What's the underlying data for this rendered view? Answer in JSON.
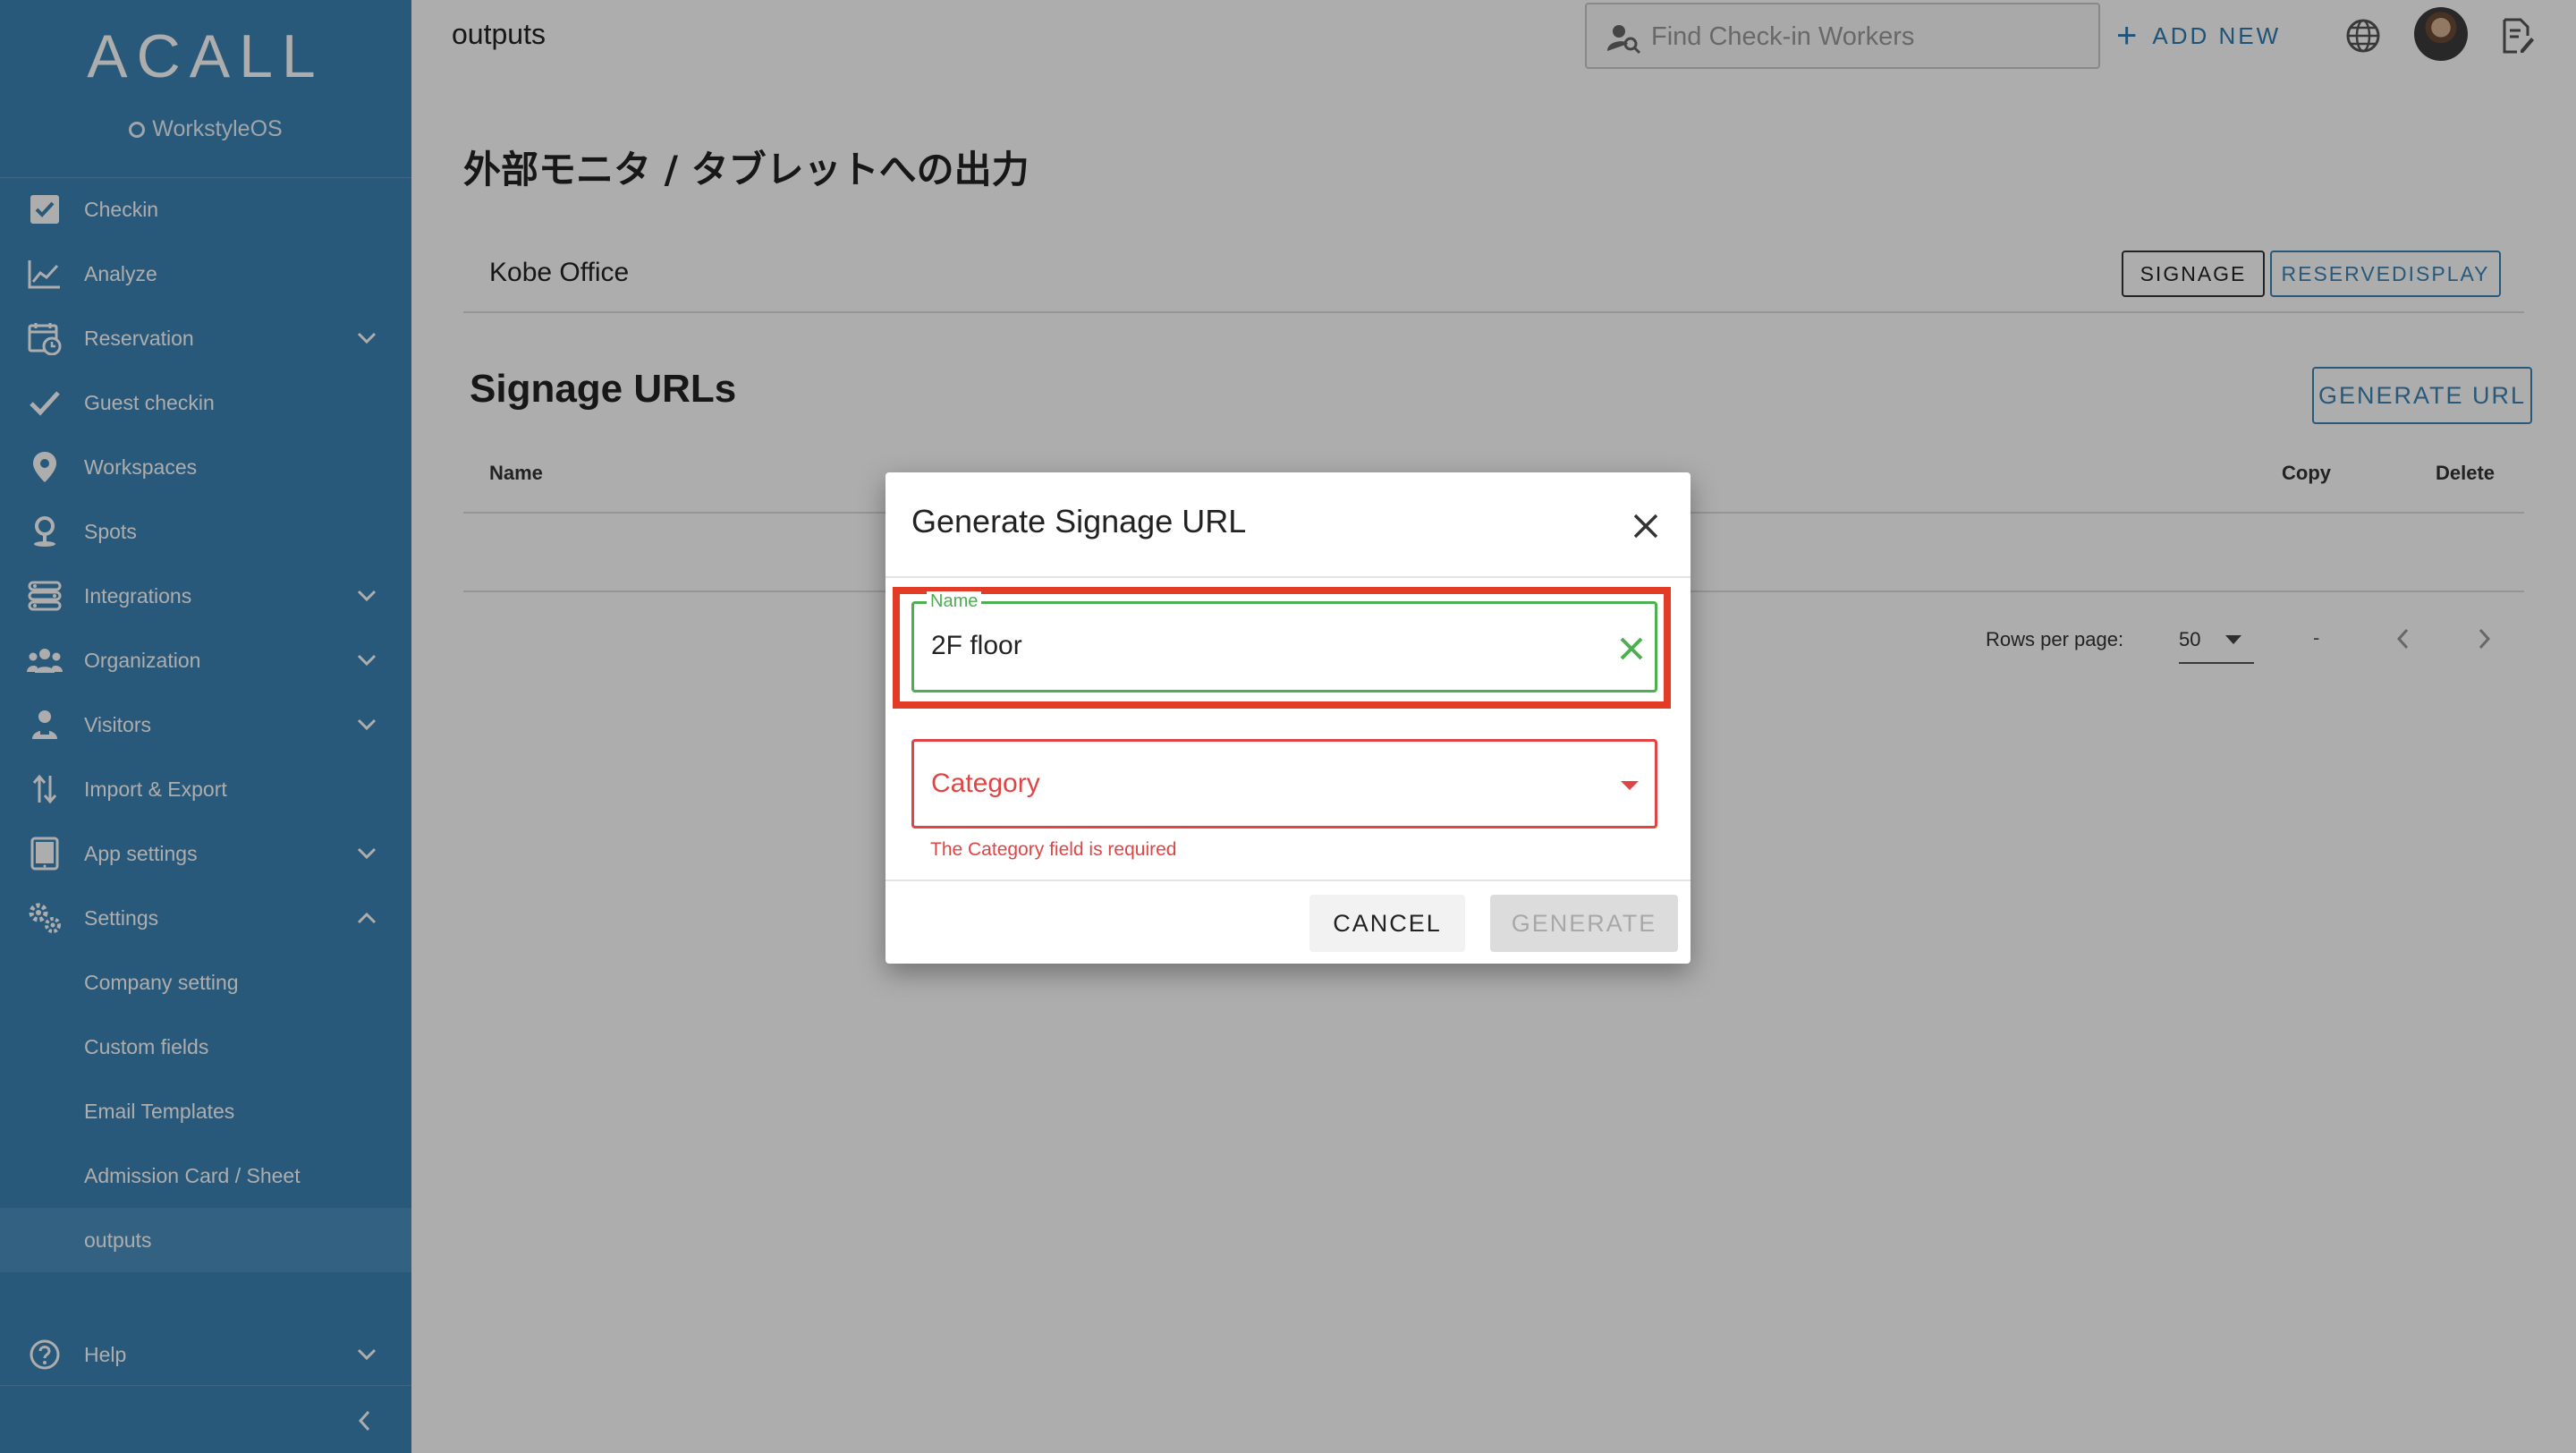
{
  "sidebar": {
    "logo": "ACALL",
    "logo_sub": "WorkstyleOS",
    "items": [
      {
        "label": "Checkin",
        "icon": "checkbox-icon"
      },
      {
        "label": "Analyze",
        "icon": "line-chart-icon"
      },
      {
        "label": "Reservation",
        "icon": "calendar-clock-icon"
      },
      {
        "label": "Guest checkin",
        "icon": "check-icon"
      },
      {
        "label": "Workspaces",
        "icon": "map-pin-icon"
      },
      {
        "label": "Spots",
        "icon": "spot-pin-icon"
      },
      {
        "label": "Integrations",
        "icon": "integrations-icon"
      },
      {
        "label": "Organization",
        "icon": "people-icon"
      },
      {
        "label": "Visitors",
        "icon": "visitor-icon"
      },
      {
        "label": "Import & Export",
        "icon": "import-export-icon"
      },
      {
        "label": "App settings",
        "icon": "tablet-icon"
      },
      {
        "label": "Settings",
        "icon": "gears-icon"
      }
    ],
    "settings_sub": [
      {
        "label": "Company setting"
      },
      {
        "label": "Custom fields"
      },
      {
        "label": "Email Templates"
      },
      {
        "label": "Admission Card / Sheet"
      },
      {
        "label": "outputs"
      }
    ],
    "help": "Help"
  },
  "topbar": {
    "title": "outputs",
    "search_placeholder": "Find Check-in Workers",
    "add_new": "ADD NEW"
  },
  "main": {
    "heading": "外部モニタ / タブレットへの出力",
    "office": "Kobe Office",
    "tabs": [
      "SIGNAGE",
      "RESERVEDISPLAY"
    ],
    "section_title": "Signage URLs",
    "generate_url": "GENERATE URL",
    "columns": {
      "name": "Name",
      "copy": "Copy",
      "delete": "Delete"
    },
    "rows_per_page_label": "Rows per page:",
    "rows_per_page_value": "50",
    "range": "-"
  },
  "dialog": {
    "title": "Generate Signage URL",
    "name_label": "Name",
    "name_value": "2F floor",
    "category_label": "Category",
    "category_error": "The Category field is required",
    "cancel": "CANCEL",
    "generate": "GENERATE"
  },
  "colors": {
    "sidebar": "#3b83b5",
    "accent": "#2f7bb0",
    "valid": "#4caf50",
    "error": "#e04545",
    "highlight": "#e23b26"
  }
}
